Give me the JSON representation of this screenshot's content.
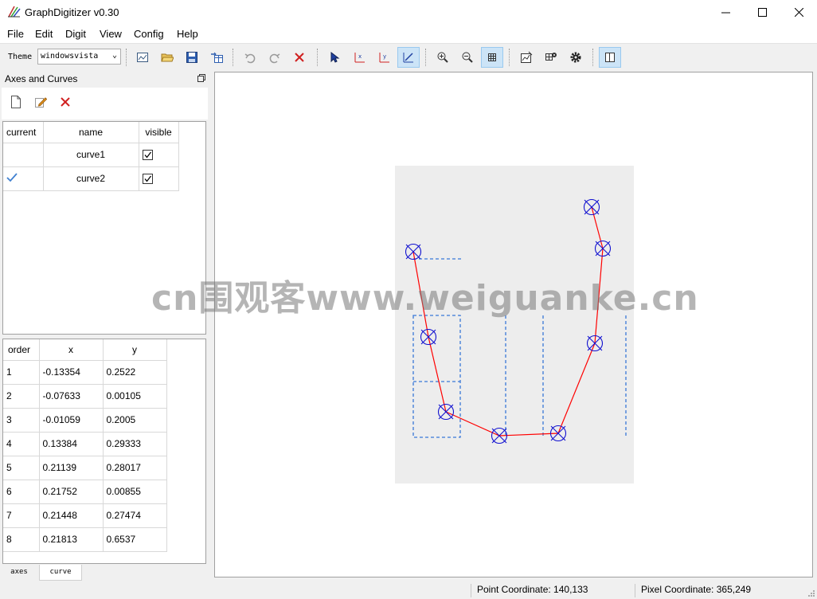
{
  "window": {
    "title": "GraphDigitizer v0.30"
  },
  "menu": {
    "items": [
      "File",
      "Edit",
      "Digit",
      "View",
      "Config",
      "Help"
    ]
  },
  "toolbar": {
    "theme_label": "Theme",
    "theme_value": "windowsvista"
  },
  "dock": {
    "title": "Axes and Curves"
  },
  "curves_table": {
    "headers": [
      "current",
      "name",
      "visible"
    ],
    "rows": [
      {
        "current": "",
        "name": "curve1",
        "visible": true
      },
      {
        "current": "check-mark-icon",
        "name": "curve2",
        "visible": true
      }
    ]
  },
  "points_table": {
    "headers": [
      "order",
      "x",
      "y"
    ],
    "rows": [
      {
        "order": "1",
        "x": "-0.13354",
        "y": "0.2522"
      },
      {
        "order": "2",
        "x": "-0.07633",
        "y": "0.00105"
      },
      {
        "order": "3",
        "x": "-0.01059",
        "y": "0.2005"
      },
      {
        "order": "4",
        "x": "0.13384",
        "y": "0.29333"
      },
      {
        "order": "5",
        "x": "0.21139",
        "y": "0.28017"
      },
      {
        "order": "6",
        "x": "0.21752",
        "y": "0.00855"
      },
      {
        "order": "7",
        "x": "0.21448",
        "y": "0.27474"
      },
      {
        "order": "8",
        "x": "0.21813",
        "y": "0.6537"
      }
    ]
  },
  "tabs": [
    "axes",
    "curve"
  ],
  "status": {
    "point_coordinate": "Point Coordinate: 140,133",
    "pixel_coordinate": "Pixel Coordinate: 365,249"
  },
  "watermark": "cn围观客www.weiguanke.cn",
  "colors": {
    "curve_line": "#ff0000",
    "marker": "#1010d0",
    "guide": "#3a78d8",
    "plot_bg": "#ededed"
  }
}
